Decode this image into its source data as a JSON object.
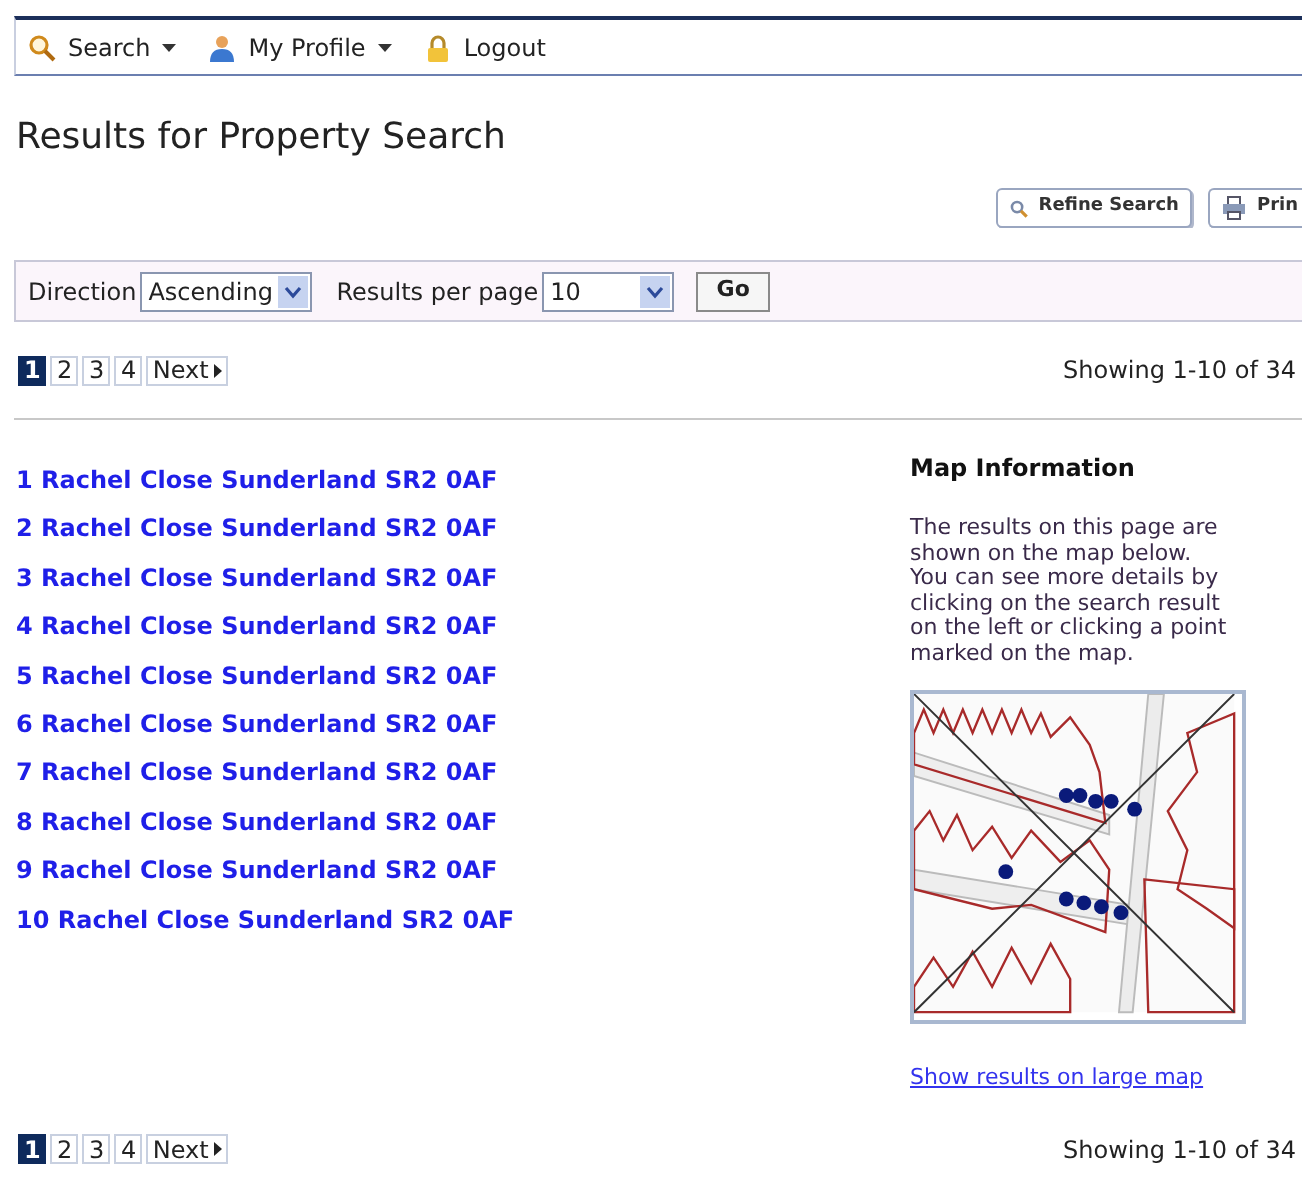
{
  "nav": [
    {
      "label": "Search",
      "kind": "search",
      "dropdown": true
    },
    {
      "label": "My Profile",
      "kind": "profile",
      "dropdown": true
    },
    {
      "label": "Logout",
      "kind": "lock",
      "dropdown": false
    }
  ],
  "title": "Results for Property Search",
  "actions": [
    {
      "label": "Refine Search",
      "kind": "search"
    },
    {
      "label": "Prin",
      "kind": "print"
    }
  ],
  "filters": {
    "direction_label": "Direction",
    "direction": "Ascending",
    "per_page_label": "Results per page",
    "per_page": "10",
    "go": "Go"
  },
  "pagination_top": {
    "pages": [
      {
        "label": "1",
        "selected": true
      },
      {
        "label": "2",
        "selected": false
      },
      {
        "label": "3",
        "selected": false
      },
      {
        "label": "4",
        "selected": false
      }
    ],
    "next": "Next",
    "showing": "Showing 1-10 of 34"
  },
  "results": [
    "1 Rachel Close Sunderland SR2 0AF",
    "2 Rachel Close Sunderland SR2 0AF",
    "3 Rachel Close Sunderland SR2 0AF",
    "4 Rachel Close Sunderland SR2 0AF",
    "5 Rachel Close Sunderland SR2 0AF",
    "6 Rachel Close Sunderland SR2 0AF",
    "7 Rachel Close Sunderland SR2 0AF",
    "8 Rachel Close Sunderland SR2 0AF",
    "9 Rachel Close Sunderland SR2 0AF",
    "10 Rachel Close Sunderland SR2 0AF"
  ],
  "map_info": {
    "heading": "Map Information",
    "text": "The results on this page are shown on the map below. You can see more details by clicking on the search result on the left or clicking a point marked on the map.",
    "link": "Show results on large map"
  },
  "pagination_bottom": {
    "pages": [
      {
        "label": "1",
        "selected": true
      },
      {
        "label": "2",
        "selected": false
      },
      {
        "label": "3",
        "selected": false
      },
      {
        "label": "4",
        "selected": false
      }
    ],
    "next": "Next",
    "showing": "Showing 1-10 of 34"
  }
}
